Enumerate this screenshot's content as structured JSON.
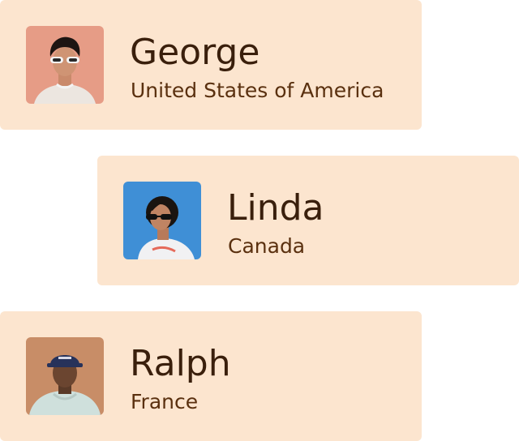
{
  "profiles": [
    {
      "name": "George",
      "country": "United States of America",
      "avatar_icon": "man-with-sunglasses-avatar",
      "avatar_bg": "#e69c86"
    },
    {
      "name": "Linda",
      "country": "Canada",
      "avatar_icon": "woman-with-sunglasses-avatar",
      "avatar_bg": "#3f8fd6"
    },
    {
      "name": "Ralph",
      "country": "France",
      "avatar_icon": "man-with-cap-avatar",
      "avatar_bg": "#c88d67"
    }
  ],
  "colors": {
    "card_background": "#fce5cf",
    "name_text": "#3a1f0c",
    "country_text": "#5a300f"
  }
}
